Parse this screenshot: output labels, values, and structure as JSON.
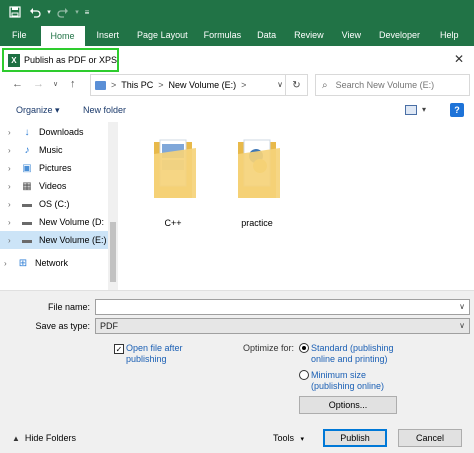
{
  "ribbon": {
    "tabs": [
      {
        "label": "File",
        "active": false
      },
      {
        "label": "Home",
        "active": true
      },
      {
        "label": "Insert",
        "active": false
      },
      {
        "label": "Page Layout",
        "active": false
      },
      {
        "label": "Formulas",
        "active": false
      },
      {
        "label": "Data",
        "active": false
      },
      {
        "label": "Review",
        "active": false
      },
      {
        "label": "View",
        "active": false
      },
      {
        "label": "Developer",
        "active": false
      },
      {
        "label": "Help",
        "active": false
      }
    ],
    "accent_color": "#217346"
  },
  "dialog": {
    "title": "Publish as PDF or XPS",
    "app_icon_letter": "X",
    "close_glyph": "✕"
  },
  "address": {
    "crumbs": [
      "This PC",
      "New Volume (E:)"
    ],
    "separator": ">",
    "search_placeholder": "Search New Volume (E:)"
  },
  "toolbar": {
    "organize_label": "Organize ▾",
    "new_folder_label": "New folder",
    "help_glyph": "?"
  },
  "navpane": {
    "items": [
      {
        "label": "Downloads",
        "icon": "download-icon",
        "glyph": "↓",
        "color": "#2a7bd4",
        "selected": false
      },
      {
        "label": "Music",
        "icon": "music-icon",
        "glyph": "♪",
        "color": "#2a7bd4",
        "selected": false
      },
      {
        "label": "Pictures",
        "icon": "pictures-icon",
        "glyph": "▣",
        "color": "#4a8fd6",
        "selected": false
      },
      {
        "label": "Videos",
        "icon": "videos-icon",
        "glyph": "▦",
        "color": "#555555",
        "selected": false
      },
      {
        "label": "OS (C:)",
        "icon": "drive-icon",
        "glyph": "▬",
        "color": "#6a6a6a",
        "selected": false
      },
      {
        "label": "New Volume (D:",
        "icon": "drive-icon",
        "glyph": "▬",
        "color": "#6a6a6a",
        "selected": false
      },
      {
        "label": "New Volume (E:)",
        "icon": "drive-icon",
        "glyph": "▬",
        "color": "#6a6a6a",
        "selected": true
      },
      {
        "label": "Network",
        "icon": "network-icon",
        "glyph": "⊞",
        "color": "#2a7bd4",
        "selected": false
      }
    ]
  },
  "files": [
    {
      "name": "C++",
      "icon": "folder-icon"
    },
    {
      "name": "practice",
      "icon": "folder-icon"
    }
  ],
  "form": {
    "file_name_label": "File name:",
    "file_name_value": "",
    "save_as_type_label": "Save as type:",
    "save_as_type_value": "PDF",
    "open_after_line1": "Open file after",
    "open_after_line2": "publishing",
    "open_after_checked": true,
    "optimize_label": "Optimize for:",
    "standard_line1": "Standard (publishing",
    "standard_line2": "online and printing)",
    "minimum_line1": "Minimum size",
    "minimum_line2": "(publishing online)",
    "options_label": "Options...",
    "hide_folders_label": "Hide Folders",
    "tools_label": "Tools",
    "publish_label": "Publish",
    "cancel_label": "Cancel"
  }
}
